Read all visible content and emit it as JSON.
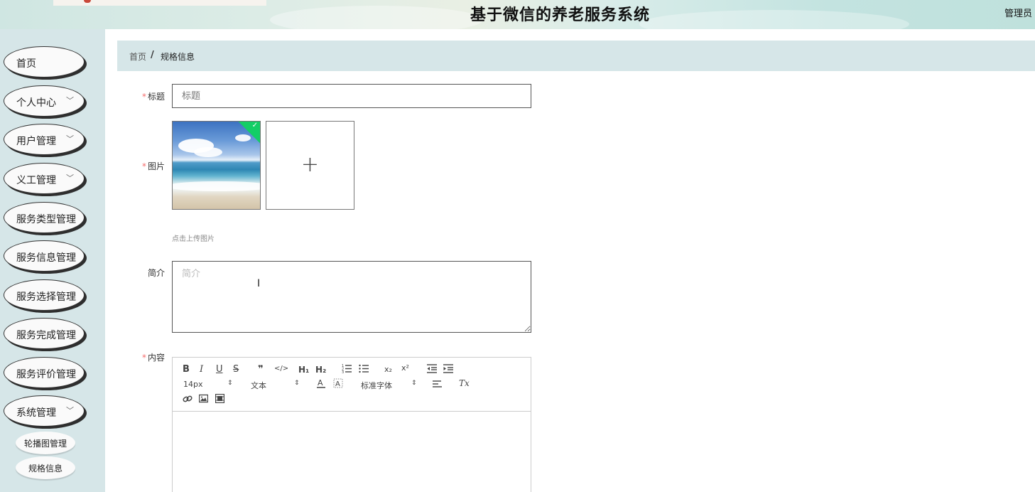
{
  "header": {
    "title": "基于微信的养老服务系统",
    "user": "管理员"
  },
  "sidebar": {
    "items": [
      {
        "label": "首页",
        "has_chevron": false
      },
      {
        "label": "个人中心",
        "has_chevron": true
      },
      {
        "label": "用户管理",
        "has_chevron": true
      },
      {
        "label": "义工管理",
        "has_chevron": true
      },
      {
        "label": "服务类型管理",
        "has_chevron": false
      },
      {
        "label": "服务信息管理",
        "has_chevron": false
      },
      {
        "label": "服务选择管理",
        "has_chevron": false
      },
      {
        "label": "服务完成管理",
        "has_chevron": false
      },
      {
        "label": "服务评价管理",
        "has_chevron": false
      },
      {
        "label": "系统管理",
        "has_chevron": true
      }
    ],
    "sub_items": [
      {
        "label": "轮播图管理"
      },
      {
        "label": "规格信息"
      }
    ]
  },
  "breadcrumb": {
    "home": "首页",
    "separator": "/",
    "current": "规格信息"
  },
  "form": {
    "required_mark": "*",
    "title_label": "标题",
    "title_placeholder": "标题",
    "image_label": "图片",
    "upload_tip": "点击上传图片",
    "intro_label": "简介",
    "intro_placeholder": "简介",
    "content_label": "内容"
  },
  "editor": {
    "bold": "B",
    "italic": "I",
    "underline": "U",
    "strike": "S",
    "blockquote": "❞",
    "code": "</>",
    "h1": "H₁",
    "h2": "H₂",
    "subscript": "x₂",
    "superscript": "x²",
    "size_value": "14px",
    "header_value": "文本",
    "font_value": "标准字体",
    "clean": "Tx"
  },
  "colors": {
    "sidebar_bg": "#d6e6e8",
    "required": "#f56c6c",
    "success_badge": "#13ce66"
  },
  "icons": [
    "chevron-down-icon",
    "check-icon",
    "plus-icon",
    "ibeam-cursor-icon",
    "link-icon",
    "image-icon",
    "video-icon",
    "ordered-list-icon",
    "bullet-list-icon",
    "outdent-icon",
    "indent-icon",
    "align-icon",
    "font-color-icon",
    "background-color-icon"
  ]
}
